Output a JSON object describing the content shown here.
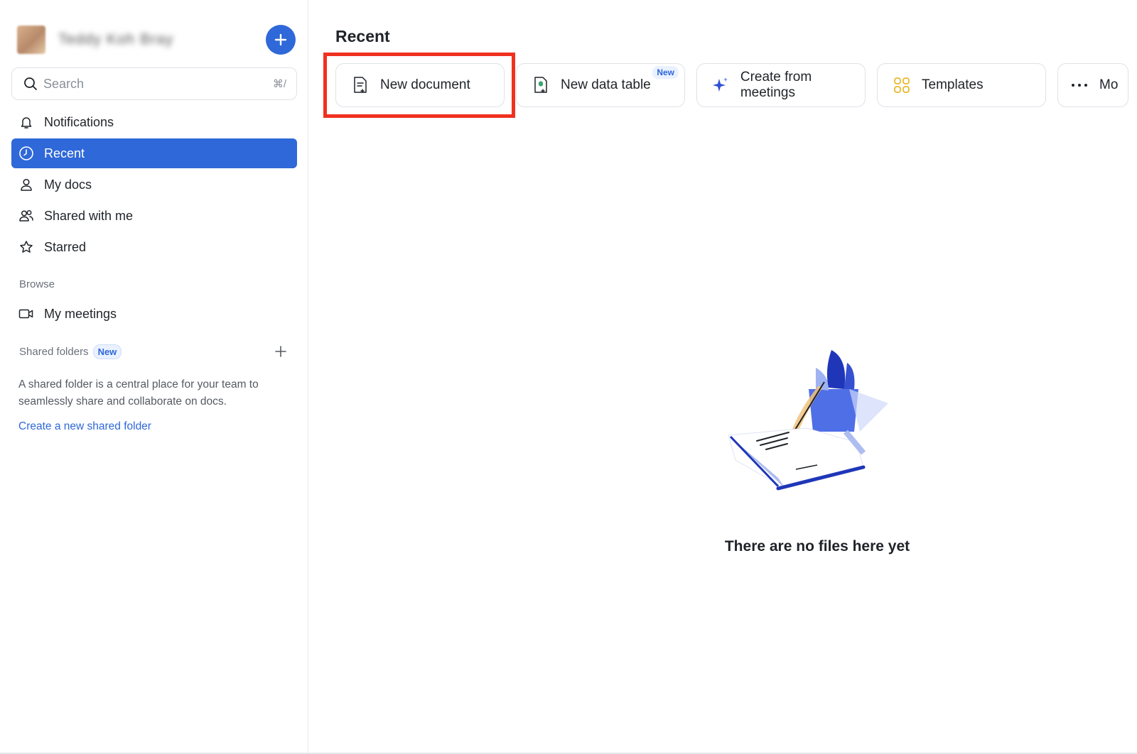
{
  "sidebar": {
    "user_name": "Teddy Koh Bray",
    "search_placeholder": "Search",
    "search_shortcut": "⌘/",
    "nav": [
      {
        "label": "Notifications",
        "icon": "bell-icon"
      },
      {
        "label": "Recent",
        "icon": "clock-icon",
        "active": true
      },
      {
        "label": "My docs",
        "icon": "person-icon"
      },
      {
        "label": "Shared with me",
        "icon": "people-icon"
      },
      {
        "label": "Starred",
        "icon": "star-icon"
      }
    ],
    "browse_label": "Browse",
    "meetings_label": "My meetings",
    "shared_folders_label": "Shared folders",
    "shared_folders_badge": "New",
    "shared_desc": "A shared folder is a central place for your team to seamlessly share and collaborate on docs.",
    "shared_link": "Create a new shared folder"
  },
  "main": {
    "title": "Recent",
    "actions": [
      {
        "label": "New document",
        "icon": "document-plus-icon"
      },
      {
        "label": "New data table",
        "icon": "data-table-icon",
        "badge": "New"
      },
      {
        "label": "Create from meetings",
        "icon": "sparkle-icon"
      },
      {
        "label": "Templates",
        "icon": "templates-icon"
      },
      {
        "label": "Mo",
        "icon": "more-dots-icon"
      }
    ],
    "empty_text": "There are no files here yet"
  },
  "colors": {
    "accent": "#2f68d8",
    "highlight": "#f0311f"
  }
}
